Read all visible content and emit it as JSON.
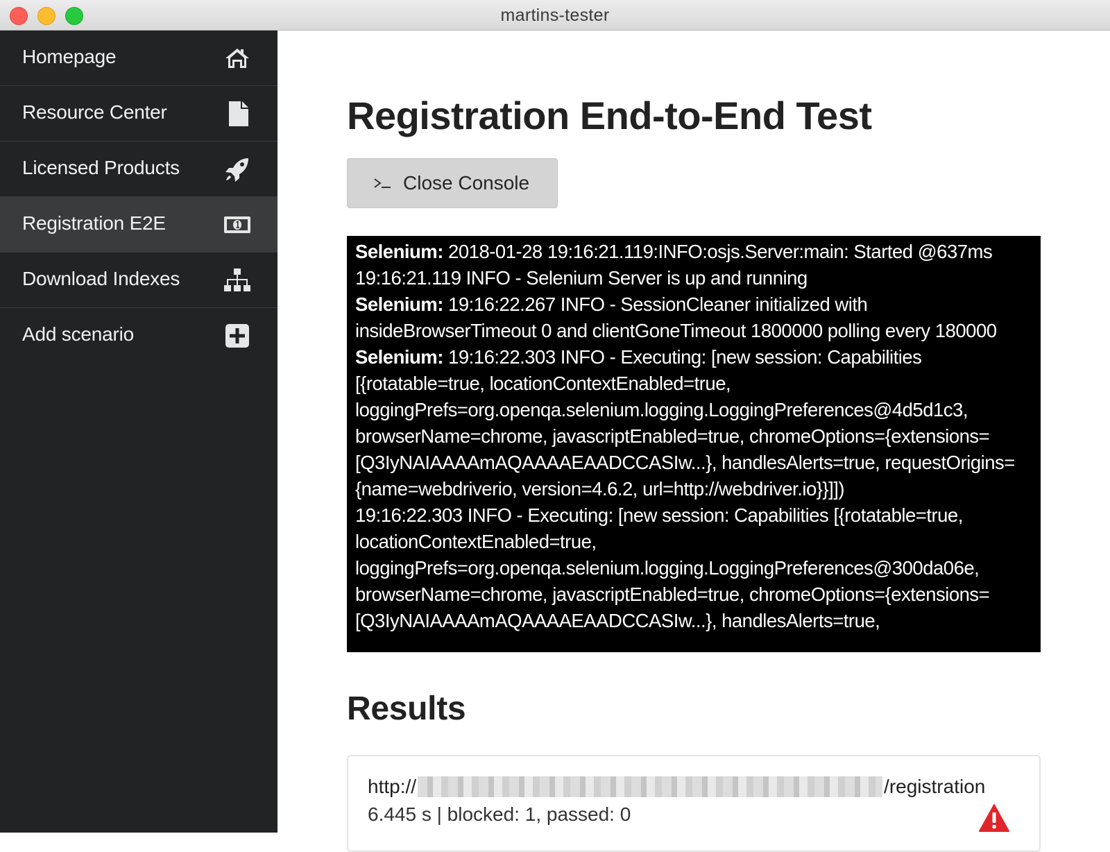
{
  "window": {
    "title": "martins-tester"
  },
  "sidebar": {
    "items": [
      {
        "label": "Homepage",
        "icon": "home-icon",
        "active": false
      },
      {
        "label": "Resource Center",
        "icon": "file-icon",
        "active": false
      },
      {
        "label": "Licensed Products",
        "icon": "rocket-icon",
        "active": false
      },
      {
        "label": "Registration E2E",
        "icon": "money-bill-icon",
        "active": true
      },
      {
        "label": "Download Indexes",
        "icon": "sitemap-icon",
        "active": false
      },
      {
        "label": "Add scenario",
        "icon": "plus-square-icon",
        "active": false
      }
    ]
  },
  "main": {
    "title": "Registration End-to-End Test",
    "console_button": {
      "label": "Close Console",
      "icon": "terminal-icon"
    },
    "console": {
      "lines": [
        {
          "tag": "Selenium:",
          "text": " 2018-01-28 19:16:21.119:INFO:osjs.Server:main: Started @637ms"
        },
        {
          "tag": "",
          "text": "19:16:21.119 INFO - Selenium Server is up and running"
        },
        {
          "tag": "Selenium:",
          "text": " 19:16:22.267 INFO - SessionCleaner initialized with insideBrowserTimeout 0 and clientGoneTimeout 1800000 polling every 180000"
        },
        {
          "tag": "Selenium:",
          "text": " 19:16:22.303 INFO - Executing: [new session: Capabilities [{rotatable=true, locationContextEnabled=true, loggingPrefs=org.openqa.selenium.logging.LoggingPreferences@4d5d1c3, browserName=chrome, javascriptEnabled=true, chromeOptions={extensions=[Q3IyNAIAAAAmAQAAAAEAADCCASIw...}, handlesAlerts=true, requestOrigins={name=webdriverio, version=4.6.2, url=http://webdriver.io}}]])"
        },
        {
          "tag": "",
          "text": "19:16:22.303 INFO - Executing: [new session: Capabilities [{rotatable=true, locationContextEnabled=true, loggingPrefs=org.openqa.selenium.logging.LoggingPreferences@300da06e, browserName=chrome, javascriptEnabled=true, chromeOptions={extensions=[Q3IyNAIAAAAmAQAAAAEAADCCASIw...}, handlesAlerts=true,"
        }
      ]
    },
    "results": {
      "title": "Results",
      "items": [
        {
          "url_prefix": "http://",
          "url_suffix": "/registration",
          "summary": "6.445 s | blocked: 1, passed: 0",
          "status_icon": "warning-icon",
          "status_color": "#e0262b"
        }
      ]
    }
  }
}
